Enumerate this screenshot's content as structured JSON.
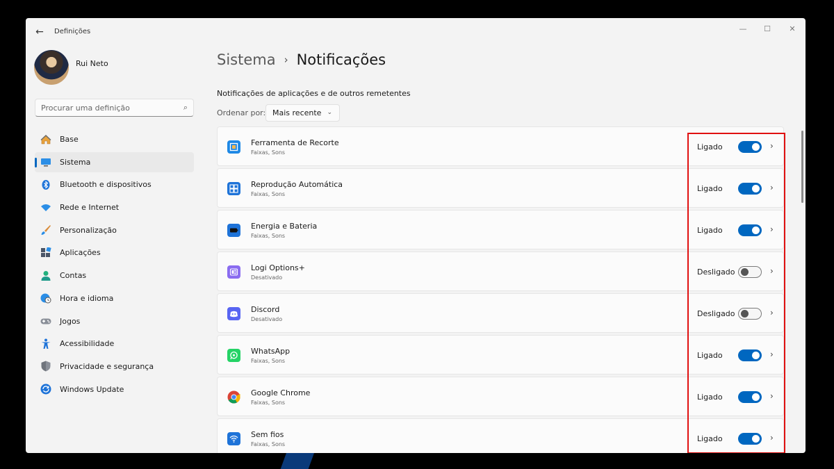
{
  "window": {
    "title": "Definições"
  },
  "profile": {
    "name": "Rui Neto"
  },
  "search": {
    "placeholder": "Procurar uma definição"
  },
  "sidebar": {
    "items": [
      {
        "label": "Base",
        "icon": "home-icon"
      },
      {
        "label": "Sistema",
        "icon": "display-icon",
        "active": true
      },
      {
        "label": "Bluetooth e dispositivos",
        "icon": "bluetooth-icon"
      },
      {
        "label": "Rede e Internet",
        "icon": "wifi-icon"
      },
      {
        "label": "Personalização",
        "icon": "brush-icon"
      },
      {
        "label": "Aplicações",
        "icon": "apps-icon"
      },
      {
        "label": "Contas",
        "icon": "person-icon"
      },
      {
        "label": "Hora e idioma",
        "icon": "globe-clock-icon"
      },
      {
        "label": "Jogos",
        "icon": "gamepad-icon"
      },
      {
        "label": "Acessibilidade",
        "icon": "accessibility-icon"
      },
      {
        "label": "Privacidade e segurança",
        "icon": "shield-icon"
      },
      {
        "label": "Windows Update",
        "icon": "update-icon"
      }
    ]
  },
  "breadcrumb": {
    "parent": "Sistema",
    "separator": "›",
    "current": "Notificações"
  },
  "main": {
    "section_title": "Notificações de aplicações e de outros remetentes",
    "sort_label": "Ordenar por:",
    "sort_value": "Mais recente",
    "apps": [
      {
        "name": "Ferramenta de Recorte",
        "sub": "Faixas, Sons",
        "state": "Ligado",
        "on": true,
        "icon": "snipping-tool-icon",
        "color": "#1e88e5"
      },
      {
        "name": "Reprodução Automática",
        "sub": "Faixas, Sons",
        "state": "Ligado",
        "on": true,
        "icon": "autoplay-icon",
        "color": "#1e73d8"
      },
      {
        "name": "Energia e Bateria",
        "sub": "Faixas, Sons",
        "state": "Ligado",
        "on": true,
        "icon": "battery-icon",
        "color": "#1e73d8"
      },
      {
        "name": "Logi Options+",
        "sub": "Desativado",
        "state": "Desligado",
        "on": false,
        "icon": "logi-options-icon",
        "color": "#8a6cf0"
      },
      {
        "name": "Discord",
        "sub": "Desativado",
        "state": "Desligado",
        "on": false,
        "icon": "discord-icon",
        "color": "#5865f2"
      },
      {
        "name": "WhatsApp",
        "sub": "Faixas, Sons",
        "state": "Ligado",
        "on": true,
        "icon": "whatsapp-icon",
        "color": "#25d366"
      },
      {
        "name": "Google Chrome",
        "sub": "Faixas, Sons",
        "state": "Ligado",
        "on": true,
        "icon": "chrome-icon",
        "color": "#ffffff"
      },
      {
        "name": "Sem fios",
        "sub": "Faixas, Sons",
        "state": "Ligado",
        "on": true,
        "icon": "wireless-icon",
        "color": "#1e73d8"
      }
    ]
  },
  "colors": {
    "accent": "#0067c0",
    "highlight_border": "#e01010"
  }
}
